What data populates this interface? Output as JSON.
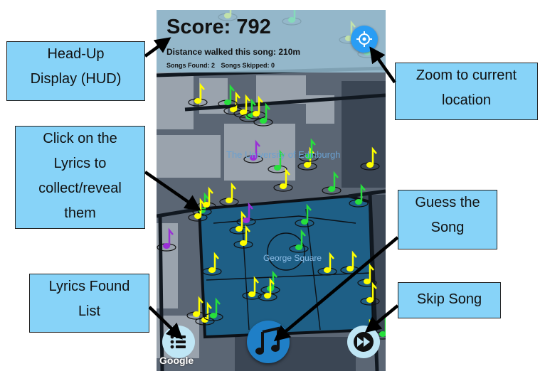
{
  "hud": {
    "score_label": "Score:",
    "score_value": "792",
    "distance_text": "Distance walked this song: 210m",
    "songs_found": "Songs Found: 2",
    "songs_skipped": "Songs Skipped: 0"
  },
  "map": {
    "square_label": "George Square",
    "university_label": "The University of Edinburgh",
    "attribution": "Google"
  },
  "callouts": {
    "hud": [
      "Head-Up",
      "Display (HUD)"
    ],
    "zoom": [
      "Zoom to current",
      "location"
    ],
    "lyrics": [
      "Click on the",
      "Lyrics to",
      "collect/reveal",
      "them"
    ],
    "guess": [
      "Guess the",
      "Song"
    ],
    "found_list": [
      "Lyrics Found",
      "List"
    ],
    "skip": [
      "Skip Song"
    ]
  },
  "icons": {
    "location": "crosshair-icon",
    "list": "list-icon",
    "guess": "music-note-icon",
    "skip": "fast-forward-icon",
    "marker": "music-note-marker-icon"
  },
  "colors": {
    "callout_bg": "#87d3f8",
    "hud_bg": "#aad7eb",
    "square_fill": "#1e5f86",
    "marker_yellow": "#ffff00",
    "marker_green": "#27e03c",
    "marker_purple": "#9a2fd6"
  }
}
